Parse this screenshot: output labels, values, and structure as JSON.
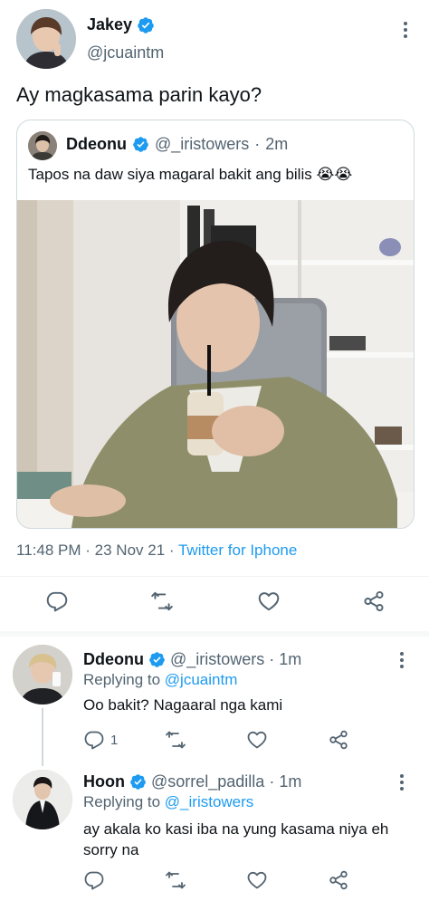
{
  "colors": {
    "accent": "#1d9bf0",
    "text": "#0f1419",
    "muted": "#536471",
    "border": "#cfd9de"
  },
  "main_tweet": {
    "name": "Jakey",
    "handle": "@jcuaintm",
    "text": "Ay magkasama parin kayo?",
    "quote": {
      "name": "Ddeonu",
      "handle": "@_iristowers",
      "separator": "·",
      "time": "2m",
      "text": "Tapos na daw siya magaral bakit ang bilis 😭😭",
      "photo_alt": "Young man in olive jacket drinking iced coffee at a white desk"
    },
    "meta": {
      "time": "11:48 PM",
      "sep1": "·",
      "date": "23 Nov 21",
      "sep2": "·",
      "source": "Twitter for Iphone"
    },
    "actions": [
      "reply-icon",
      "retweet-icon",
      "like-icon",
      "share-icon"
    ]
  },
  "replies": [
    {
      "name": "Ddeonu",
      "handle": "@_iristowers",
      "separator": "·",
      "time": "1m",
      "replying_label": "Replying to",
      "replying_to": "@jcuaintm",
      "text": "Oo bakit? Nagaaral nga kami",
      "reply_count": "1"
    },
    {
      "name": "Hoon",
      "handle": "@sorrel_padilla",
      "separator": "·",
      "time": "1m",
      "replying_label": "Replying to",
      "replying_to": "@_iristowers",
      "text": "ay akala ko kasi iba na yung kasama niya eh sorry na",
      "reply_count": ""
    }
  ]
}
